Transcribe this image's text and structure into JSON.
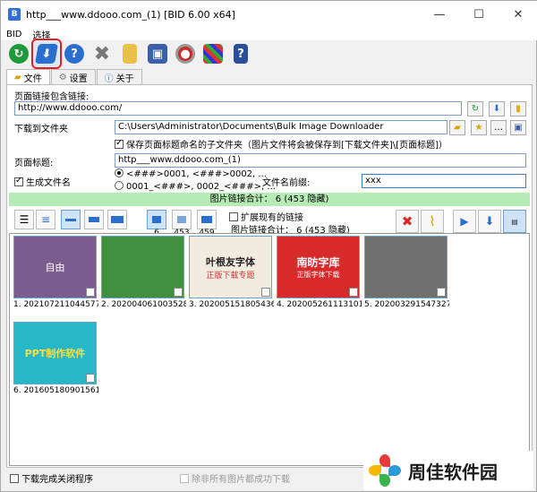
{
  "window": {
    "title": "http___www.ddooo.com_(1) [BID 6.00 x64]",
    "app_icon_letter": "B"
  },
  "menu": [
    "BID",
    "选择"
  ],
  "tabs": [
    {
      "label": "文件"
    },
    {
      "label": "设置"
    },
    {
      "label": "关于"
    }
  ],
  "form": {
    "page_link_label": "页面链接包含链接:",
    "page_link_value": "http://www.ddooo.com/",
    "download_folder_label": "下载到文件夹",
    "download_folder_value": "C:\\Users\\Administrator\\Documents\\Bulk Image Downloader",
    "save_subfolder_label": "保存页面标题命名的子文件夹（图片文件将会被保存到[下载文件夹]\\[页面标题]）",
    "page_title_label": "页面标题:",
    "page_title_value": "http___www.ddooo.com_(1)",
    "gen_filename_label": "生成文件名",
    "radio1": "<###>0001, <###>0002, ...",
    "radio2": "0001_<###>, 0002_<###>, ...",
    "prefix_label": "文件名前缀:",
    "prefix_value": "xxx"
  },
  "summary_bar": "图片链接合计： 6 (453 隐藏)",
  "counts": {
    "c1": "6",
    "c2": "453",
    "c3": "459"
  },
  "expand_label": "扩展现有的链接",
  "link_total": "图片链接合计： 6 (453 隐藏)",
  "thumbnails": [
    {
      "caption": "1. 2021072110445778...",
      "color": "#7a5c8e"
    },
    {
      "caption": "2. 2020040610035285...",
      "color": "#3f8f3f"
    },
    {
      "caption": "3. 2020051518054367...",
      "color": "#f2ece0"
    },
    {
      "caption": "4. 2020052611131012...",
      "color": "#d82a2a"
    },
    {
      "caption": "5. 2020032915473279...",
      "color": "#6f6f6f"
    },
    {
      "caption": "6. 2016051809015619...",
      "color": "#27b8c8"
    }
  ],
  "thumb_text": {
    "t1": "自由",
    "t3a": "叶根友字体",
    "t3b": "正版下载专题",
    "t4a": "南昉字库",
    "t4b": "正版字体下载",
    "t6": "PPT制作软件"
  },
  "status": {
    "close_after": "下载完成关闭程序",
    "remove_after": "除非所有图片都成功下载"
  },
  "logo_text": "周佳软件园"
}
